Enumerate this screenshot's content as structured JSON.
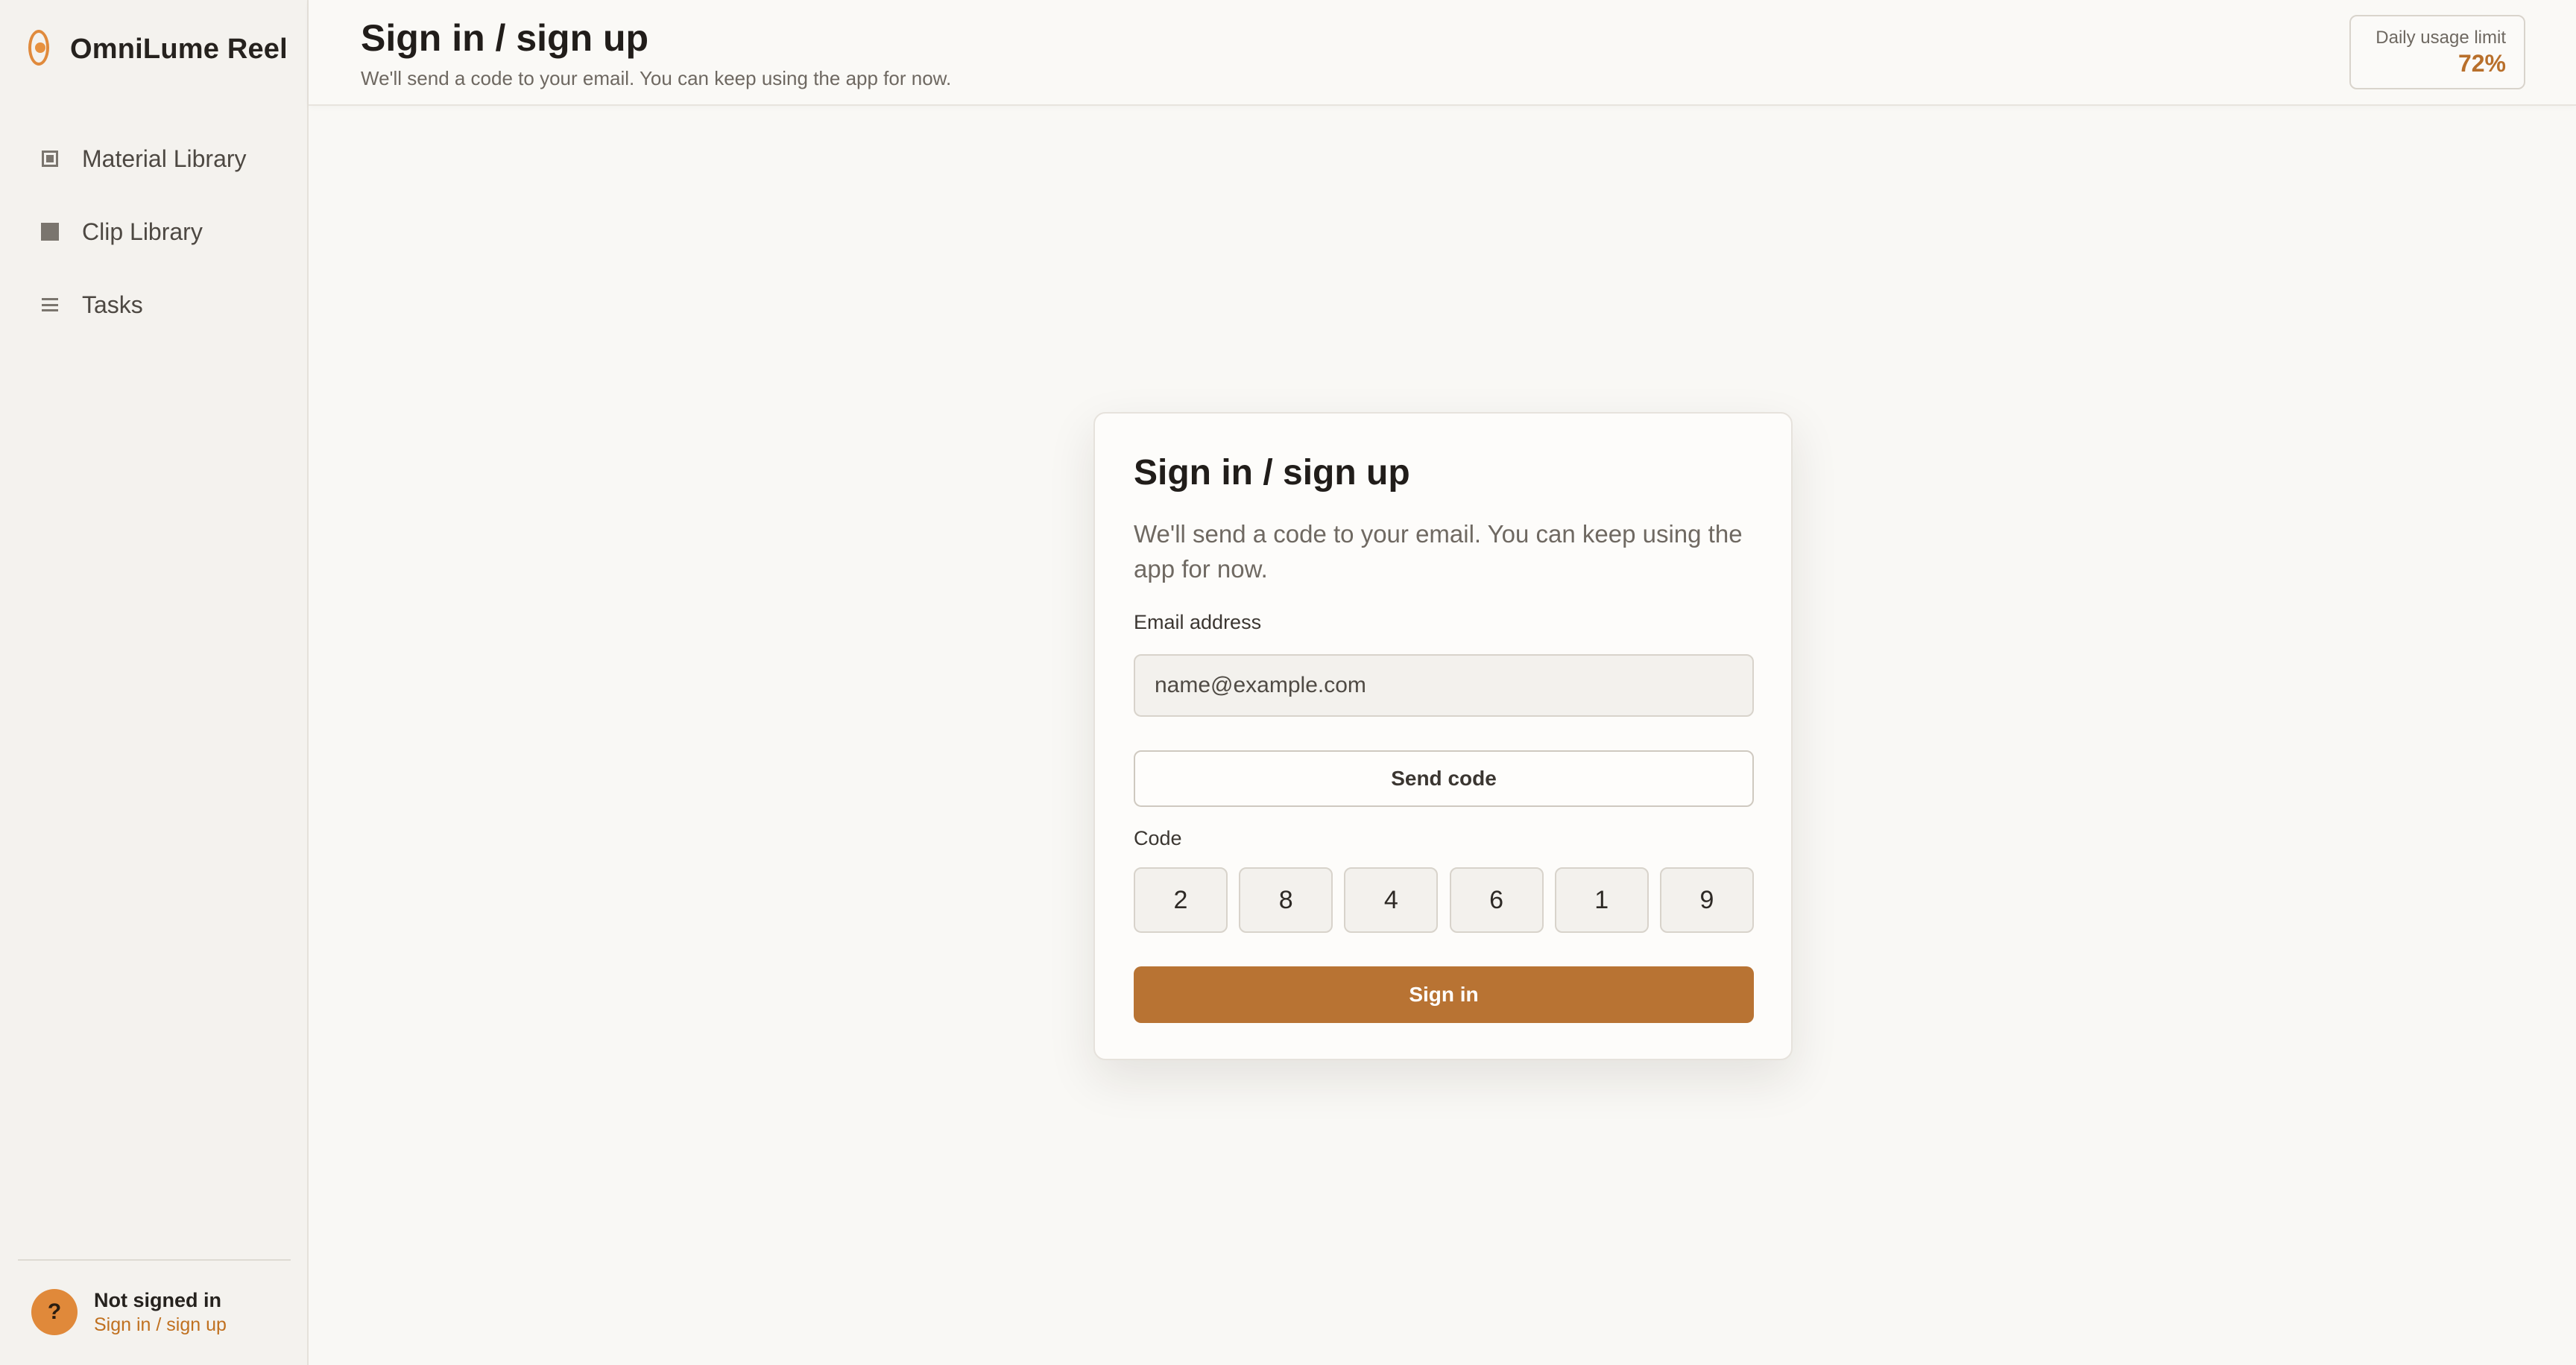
{
  "app": {
    "name": "OmniLume Reel",
    "logo_icon": "flame-ring-icon",
    "accent_color": "#b87333",
    "brand_color": "#e08a3c"
  },
  "sidebar": {
    "items": [
      {
        "label": "Material Library",
        "icon": "framed-square-icon"
      },
      {
        "label": "Clip Library",
        "icon": "filled-square-icon"
      },
      {
        "label": "Tasks",
        "icon": "list-lines-icon"
      }
    ],
    "user": {
      "avatar_glyph": "?",
      "status": "Not signed in",
      "link": "Sign in / sign up"
    }
  },
  "header": {
    "title": "Sign in / sign up",
    "subtitle": "We'll send a code to your email. You can keep using the app for now.",
    "usage": {
      "label": "Daily usage limit",
      "value": "72%"
    }
  },
  "card": {
    "title": "Sign in / sign up",
    "description": "We'll send a code to your email. You can keep using the app for now.",
    "email_label": "Email address",
    "email_value": "",
    "email_placeholder": "name@example.com",
    "send_code_label": "Send code",
    "code_label": "Code",
    "code_digits": [
      "2",
      "8",
      "4",
      "6",
      "1",
      "9"
    ],
    "sign_in_label": "Sign in"
  }
}
